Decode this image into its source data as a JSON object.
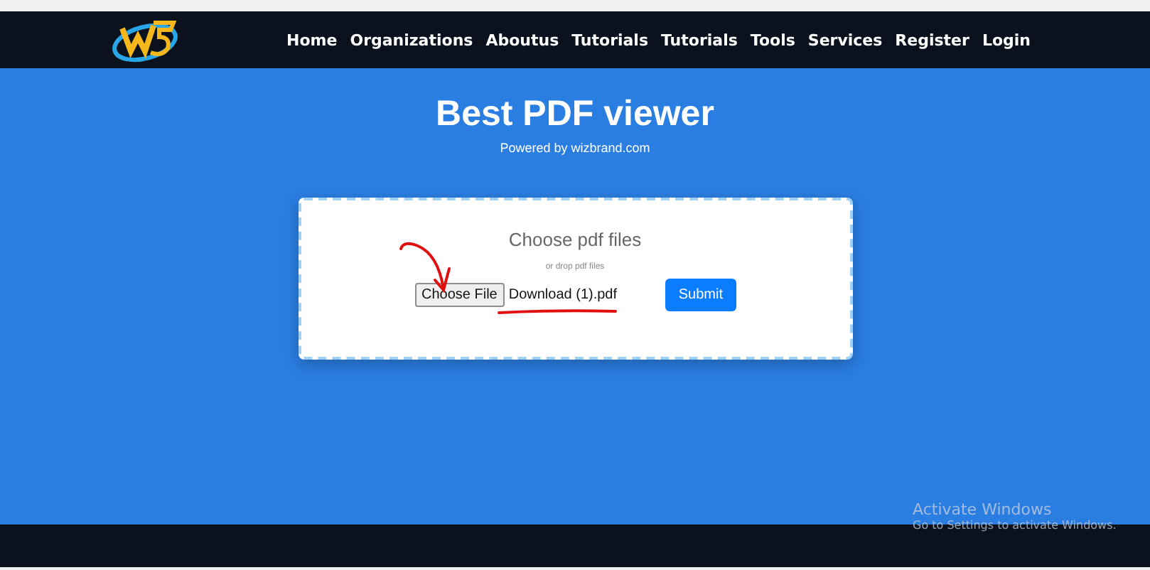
{
  "nav": {
    "links": [
      {
        "label": "Home"
      },
      {
        "label": "Organizations"
      },
      {
        "label": "Aboutus"
      },
      {
        "label": "Tutorials"
      },
      {
        "label": "Tutorials"
      },
      {
        "label": "Tools"
      },
      {
        "label": "Services"
      },
      {
        "label": "Register"
      },
      {
        "label": "Login"
      }
    ]
  },
  "hero": {
    "title": "Best PDF viewer",
    "subtitle": "Powered by wizbrand.com"
  },
  "upload": {
    "heading": "Choose pdf files",
    "hint": "or drop pdf files",
    "file_button": "Choose File",
    "file_name": "Download (1).pdf",
    "submit": "Submit"
  },
  "os_overlay": {
    "title": "Activate Windows",
    "message": "Go to Settings to activate Windows."
  }
}
